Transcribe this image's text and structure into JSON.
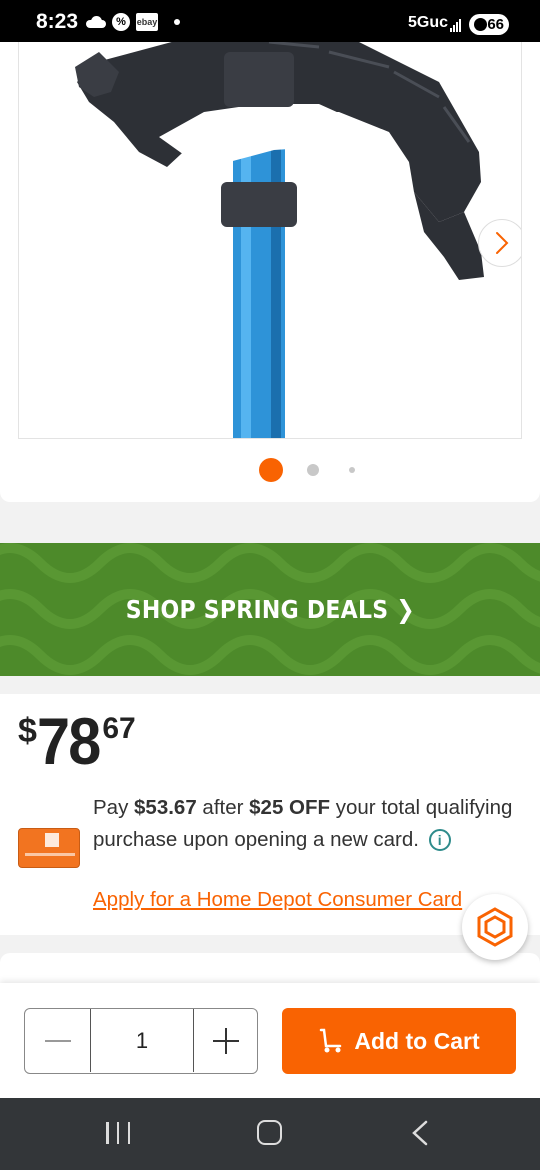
{
  "status_bar": {
    "time": "8:23",
    "ebay": "ebay",
    "network": "5Guc",
    "battery": "66",
    "icons": [
      "cloud-icon",
      "tag-icon",
      "ebay-icon",
      "dot-icon",
      "signal-icon",
      "battery-icon"
    ]
  },
  "gallery": {
    "dots_count": 3,
    "active_index": 0,
    "next_icon": "chevron-right-icon",
    "accent_color": "#f96302"
  },
  "banner": {
    "text": "SHOP SPRING DEALS ❯",
    "color": "#4d8a2a"
  },
  "price": {
    "dollar_sign": "$",
    "whole": "78",
    "cents": "67"
  },
  "promo": {
    "pay_prefix": "Pay ",
    "pay_amount": "$53.67",
    "after_text": " after ",
    "discount": "$25 OFF",
    "rest_text": " your total qualifying purchase upon opening a new card.",
    "info_icon": "i",
    "apply_link": "Apply for a Home Depot Consumer Card"
  },
  "cart": {
    "quantity": "1",
    "add_to_cart_label": "Add to Cart",
    "button_color": "#f96302"
  },
  "nav": {
    "icons": [
      "recent-apps-icon",
      "home-icon",
      "back-icon"
    ]
  }
}
